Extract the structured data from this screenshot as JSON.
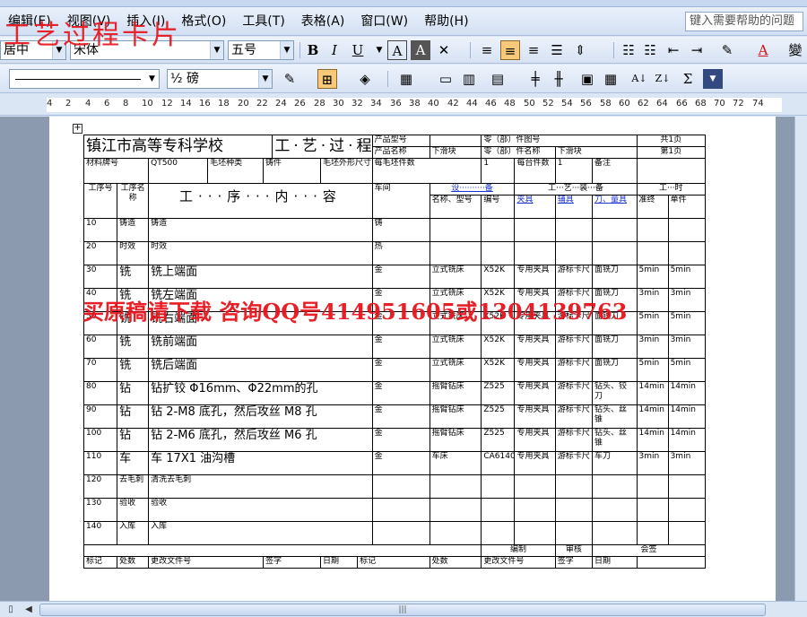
{
  "watermark": {
    "top": "工艺过程卡片",
    "middle": "买原稿请下载  咨询QQ号414951605或1304139763"
  },
  "menu": {
    "items": [
      "编辑(E)",
      "视图(V)",
      "插入(I)",
      "格式(O)",
      "工具(T)",
      "表格(A)",
      "窗口(W)",
      "帮助(H)"
    ],
    "help_placeholder": "键入需要帮助的问题"
  },
  "format_toolbar": {
    "style": "居中",
    "font": "宋体",
    "size": "五号",
    "bold": "B",
    "italic": "I",
    "underline": "U",
    "char_border": "A",
    "char_shade": "A",
    "sort": "A↓Z",
    "font_color": "A",
    "extra": "變"
  },
  "draw_toolbar": {
    "line_weight": "½ 磅",
    "sigma": "Σ"
  },
  "ruler": {
    "numbers": [
      "4",
      "2",
      "4",
      "6",
      "8",
      "10",
      "12",
      "14",
      "16",
      "18",
      "20",
      "22",
      "24",
      "26",
      "28",
      "30",
      "32",
      "34",
      "36",
      "38",
      "40",
      "42",
      "44",
      "46",
      "48",
      "50",
      "52",
      "54",
      "56",
      "58",
      "60",
      "62",
      "64",
      "66",
      "68",
      "70",
      "72",
      "74"
    ]
  },
  "card": {
    "school": "镇江市高等专科学校",
    "title": "工·艺·过·程·卡",
    "product_model_label": "产品型号",
    "part_no_label": "零（部）件图号",
    "total_pages": "共1页",
    "product_name_label": "产品名称",
    "product_name_value": "下滑块",
    "part_name_label": "零（部）件名称",
    "part_name_value": "下滑块",
    "page_no": "第1页",
    "material_label": "材料牌号",
    "material_value": "QT500",
    "blank_type_label": "毛坯种类",
    "blank_type_value": "铸件",
    "blank_size_label": "毛坯外形尺寸",
    "per_blank_label": "每毛坯件数",
    "per_blank_value": "1",
    "per_unit_label": "每台件数",
    "per_unit_value": "1",
    "remark_label": "备注",
    "h_step_no": "工序号",
    "h_step_name": "工序名称",
    "h_content": "工···序···内···容",
    "h_workshop": "车间",
    "h_equipment": "设··········备",
    "h_tooling": "工···艺···装···备",
    "h_time": "工···时",
    "h_eq_name": "名称、型号",
    "h_eq_no": "编号",
    "h_fixture": "夹具",
    "h_gauge": "辅具",
    "h_tool": "刀、量具",
    "h_prep": "准终",
    "h_unit": "单件",
    "rows": [
      {
        "no": "10",
        "name": "铸造",
        "content": "铸造",
        "shop": "铸",
        "eq": "",
        "eqno": "",
        "fix": "",
        "gauge": "",
        "tool": "",
        "prep": "",
        "unit": ""
      },
      {
        "no": "20",
        "name": "时效",
        "content": "时效",
        "shop": "热",
        "eq": "",
        "eqno": "",
        "fix": "",
        "gauge": "",
        "tool": "",
        "prep": "",
        "unit": ""
      },
      {
        "no": "30",
        "name": "铣",
        "content": "铣上端面",
        "shop": "金",
        "eq": "立式铣床",
        "eqno": "X52K",
        "fix": "专用夹具",
        "gauge": "游标卡尺",
        "tool": "面铣刀",
        "prep": "5min",
        "unit": "5min"
      },
      {
        "no": "40",
        "name": "铣",
        "content": "铣左端面",
        "shop": "金",
        "eq": "立式铣床",
        "eqno": "X52K",
        "fix": "专用夹具",
        "gauge": "游标卡尺",
        "tool": "面铣刀",
        "prep": "3min",
        "unit": "3min"
      },
      {
        "no": "50",
        "name": "铣",
        "content": "铣右端面",
        "shop": "金",
        "eq": "立式铣床",
        "eqno": "X52K",
        "fix": "专用夹具",
        "gauge": "游标卡尺",
        "tool": "面铣刀",
        "prep": "5min",
        "unit": "5min"
      },
      {
        "no": "60",
        "name": "铣",
        "content": "铣前端面",
        "shop": "金",
        "eq": "立式铣床",
        "eqno": "X52K",
        "fix": "专用夹具",
        "gauge": "游标卡尺",
        "tool": "面铣刀",
        "prep": "3min",
        "unit": "3min"
      },
      {
        "no": "70",
        "name": "铣",
        "content": "铣后端面",
        "shop": "金",
        "eq": "立式铣床",
        "eqno": "X52K",
        "fix": "专用夹具",
        "gauge": "游标卡尺",
        "tool": "面铣刀",
        "prep": "5min",
        "unit": "5min"
      },
      {
        "no": "80",
        "name": "钻",
        "content": "钻扩铰 Φ16mm、Φ22mm的孔",
        "shop": "金",
        "eq": "摇臂钻床",
        "eqno": "Z525",
        "fix": "专用夹具",
        "gauge": "游标卡尺",
        "tool": "钻头、铰刀",
        "prep": "14min",
        "unit": "14min"
      },
      {
        "no": "90",
        "name": "钻",
        "content": "钻 2-M8 底孔，然后攻丝 M8 孔",
        "shop": "金",
        "eq": "摇臂钻床",
        "eqno": "Z525",
        "fix": "专用夹具",
        "gauge": "游标卡尺",
        "tool": "钻头、丝锥",
        "prep": "14min",
        "unit": "14min"
      },
      {
        "no": "100",
        "name": "钻",
        "content": "钻 2-M6 底孔，然后攻丝 M6 孔",
        "shop": "金",
        "eq": "摇臂钻床",
        "eqno": "Z525",
        "fix": "专用夹具",
        "gauge": "游标卡尺",
        "tool": "钻头、丝锥",
        "prep": "14min",
        "unit": "14min"
      },
      {
        "no": "110",
        "name": "车",
        "content": "车 17X1 油沟槽",
        "shop": "金",
        "eq": "车床",
        "eqno": "CA6140",
        "fix": "专用夹具",
        "gauge": "游标卡尺",
        "tool": "车刀",
        "prep": "3min",
        "unit": "3min"
      },
      {
        "no": "120",
        "name": "去毛刺",
        "content": "清洗去毛刺",
        "shop": "",
        "eq": "",
        "eqno": "",
        "fix": "",
        "gauge": "",
        "tool": "",
        "prep": "",
        "unit": ""
      },
      {
        "no": "130",
        "name": "验收",
        "content": "验收",
        "shop": "",
        "eq": "",
        "eqno": "",
        "fix": "",
        "gauge": "",
        "tool": "",
        "prep": "",
        "unit": ""
      },
      {
        "no": "140",
        "name": "入库",
        "content": "入库",
        "shop": "",
        "eq": "",
        "eqno": "",
        "fix": "",
        "gauge": "",
        "tool": "",
        "prep": "",
        "unit": ""
      }
    ],
    "compile_label": "编制",
    "review_label": "审核",
    "approve_label": "会签",
    "footer": [
      "标记",
      "处数",
      "更改文件号",
      "签字",
      "日期",
      "标记",
      "处数",
      "更改文件号",
      "签字",
      "日期"
    ]
  }
}
